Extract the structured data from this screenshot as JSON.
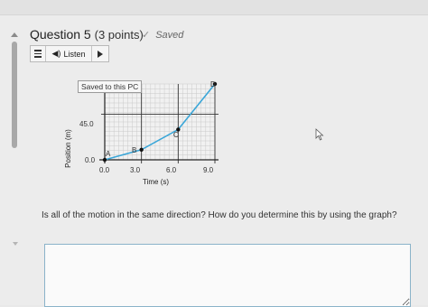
{
  "question": {
    "title": "Question 5",
    "points": "(3 points)",
    "saved_label": "Saved",
    "prompt": "Is all of the motion in the same direction? How do you determine this by using the graph?"
  },
  "toolbar": {
    "listen_label": "Listen"
  },
  "graph": {
    "tooltip": "Saved to this PC",
    "y_tick_labels": [
      "45.0",
      "0.0"
    ],
    "x_tick_labels": [
      "0.0",
      "3.0",
      "6.0",
      "9.0"
    ],
    "point_labels": [
      "A",
      "B",
      "C",
      "D"
    ]
  },
  "chart_data": {
    "type": "line",
    "xlabel": "Time (s)",
    "ylabel": "Position (m)",
    "x": [
      0,
      3,
      6,
      9
    ],
    "y": [
      0,
      10,
      30,
      75
    ],
    "point_labels": [
      "A",
      "B",
      "C",
      "D"
    ],
    "xlim": [
      0,
      9
    ],
    "ylim": [
      0,
      75
    ],
    "grid": true,
    "line_color": "#3aa6d8"
  },
  "answer": {
    "value": ""
  }
}
